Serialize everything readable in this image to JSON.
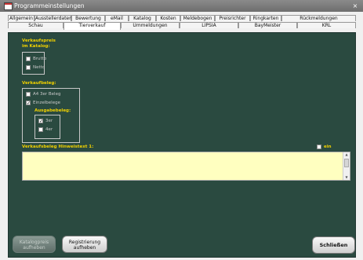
{
  "window": {
    "title": "Programmeinstellungen",
    "close": "×"
  },
  "tabs": {
    "row1": [
      "Allgemein",
      "Ausstellerdaten",
      "Bewertung",
      "eMail",
      "Katalog",
      "Kosten",
      "Meldebogen",
      "Preisrichter",
      "Ringkarten",
      "Rückmeldungen"
    ],
    "row2": [
      "Schau",
      "Tierverkauf",
      "Ummeldungen",
      "LIPSIA",
      "BayMeister",
      "KRL"
    ],
    "active": "Tierverkauf"
  },
  "verkaufspreis": {
    "label_line1": "Verkaufspreis",
    "label_line2": "im Katalog:",
    "brutto": {
      "label": "Brutto",
      "checked": false
    },
    "netto": {
      "label": "Netto",
      "checked": false
    }
  },
  "verkaufsbeleg": {
    "label": "Verkaufbeleg:",
    "a4": {
      "label": "A4 3er Beleg",
      "checked": false
    },
    "einzel": {
      "label": "Einzelbelege",
      "checked": true
    },
    "ausgabe_label": "Ausgabebeleg:",
    "opt3": {
      "label": "3er",
      "checked": true
    },
    "opt4": {
      "label": "4er",
      "checked": false
    }
  },
  "hinweis": {
    "label": "Verkaufsbeleg Hinweistext 1:",
    "ein_label": "ein",
    "ein_checked": false,
    "text": ""
  },
  "buttons": {
    "katalog": "Katalogpreis aufheben",
    "registrierung_line1": "Registrierung",
    "registrierung_line2": "aufheben",
    "schliessen": "Schließen"
  }
}
